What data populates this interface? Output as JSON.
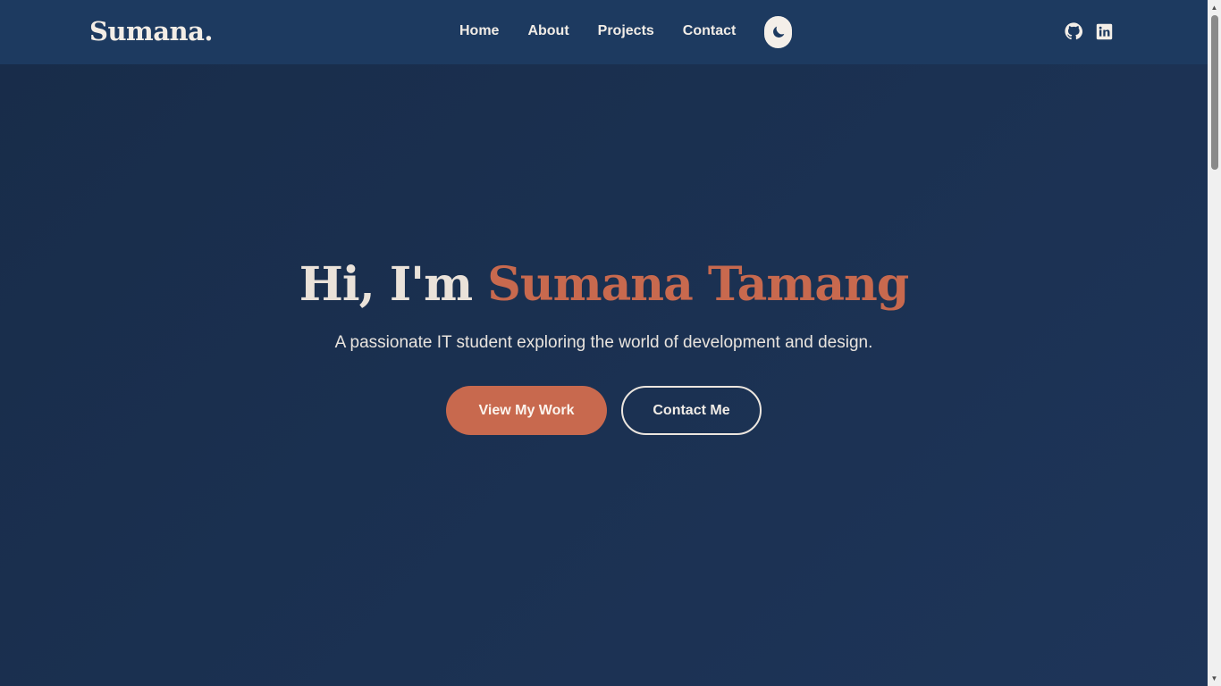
{
  "brand": {
    "logo": "Sumana."
  },
  "nav": {
    "items": [
      {
        "label": "Home"
      },
      {
        "label": "About"
      },
      {
        "label": "Projects"
      },
      {
        "label": "Contact"
      }
    ],
    "theme_toggle_icon": "moon-icon",
    "social": [
      {
        "icon": "github-icon"
      },
      {
        "icon": "linkedin-icon"
      }
    ]
  },
  "hero": {
    "greeting": "Hi, I'm ",
    "name": "Sumana Tamang",
    "subtitle": "A passionate IT student exploring the world of development and design.",
    "primary_button": "View My Work",
    "secondary_button": "Contact Me"
  },
  "colors": {
    "background": "#1a2f4e",
    "navbar": "#1d3a60",
    "accent": "#c8694e",
    "text_light": "#eae2d9"
  }
}
